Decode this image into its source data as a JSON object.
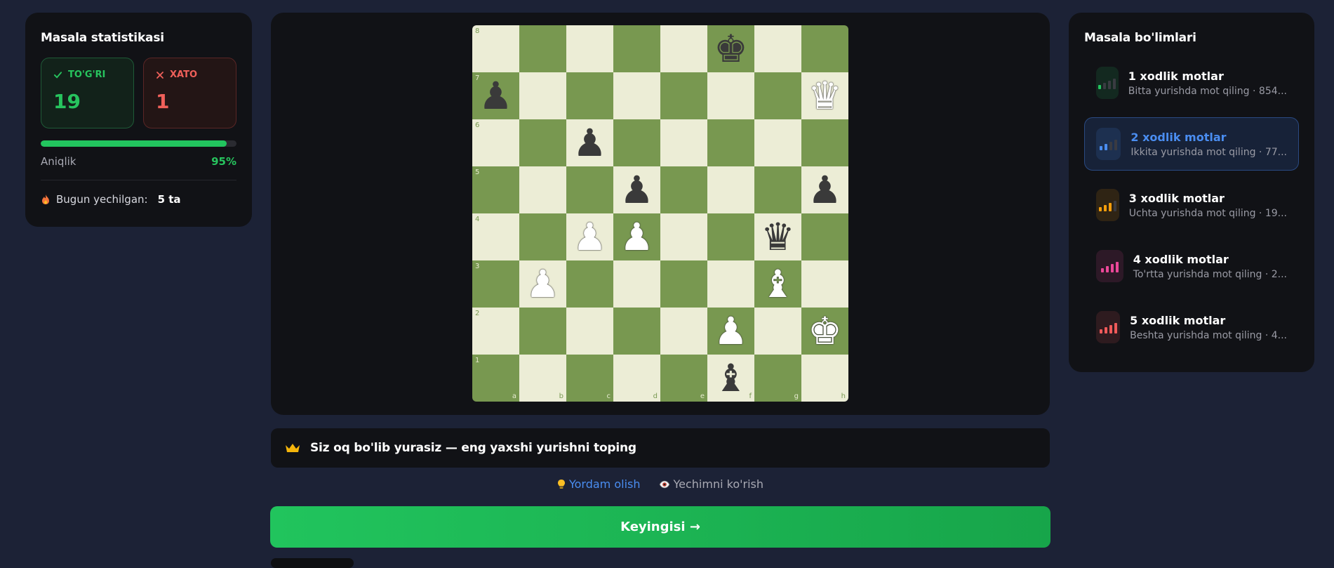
{
  "stats": {
    "title": "Masala statistikasi",
    "correct_label": "TO'G'RI",
    "correct_value": "19",
    "wrong_label": "XATO",
    "wrong_value": "1",
    "accuracy_label": "Aniqlik",
    "accuracy_value": "95%",
    "accuracy_fraction": 0.95,
    "today_label": "Bugun yechilgan:",
    "today_value": "5 ta"
  },
  "board": {
    "files": [
      "a",
      "b",
      "c",
      "d",
      "e",
      "f",
      "g",
      "h"
    ],
    "ranks": [
      "8",
      "7",
      "6",
      "5",
      "4",
      "3",
      "2",
      "1"
    ],
    "light_color": "#ecedd6",
    "dark_color": "#789850",
    "pieces": {
      "f8": "bK",
      "a7": "bP",
      "h7": "wQ",
      "c6": "bP",
      "d5": "bP",
      "h5": "bP",
      "c4": "wP",
      "d4": "wP",
      "g4": "bQ",
      "b3": "wP",
      "g3": "wB",
      "f2": "wP",
      "h2": "wK",
      "f1": "bB"
    }
  },
  "hint": {
    "text": "Siz oq bo'lib yurasiz — eng yaxshi yurishni toping"
  },
  "actions": {
    "help": "Yordam olish",
    "solution": "Yechimni ko'rish"
  },
  "next_button": "Keyingisi →",
  "sections": {
    "title": "Masala bo'limlari",
    "items": [
      {
        "name": "1 xodlik motlar",
        "desc": "Bitta yurishda mot qiling · 854...",
        "color": "#22c55e",
        "level": 1,
        "active": false
      },
      {
        "name": "2 xodlik motlar",
        "desc": "Ikkita yurishda mot qiling · 77...",
        "color": "#4a8df0",
        "level": 2,
        "active": true
      },
      {
        "name": "3 xodlik motlar",
        "desc": "Uchta yurishda mot qiling · 19...",
        "color": "#f59e0b",
        "level": 3,
        "active": false
      },
      {
        "name": "4 xodlik motlar",
        "desc": "To'rtta yurishda mot qiling · 2...",
        "color": "#ec4899",
        "level": 4,
        "active": false
      },
      {
        "name": "5 xodlik motlar",
        "desc": "Beshta yurishda mot qiling · 4...",
        "color": "#f05a5a",
        "level": 4,
        "active": false
      }
    ]
  }
}
